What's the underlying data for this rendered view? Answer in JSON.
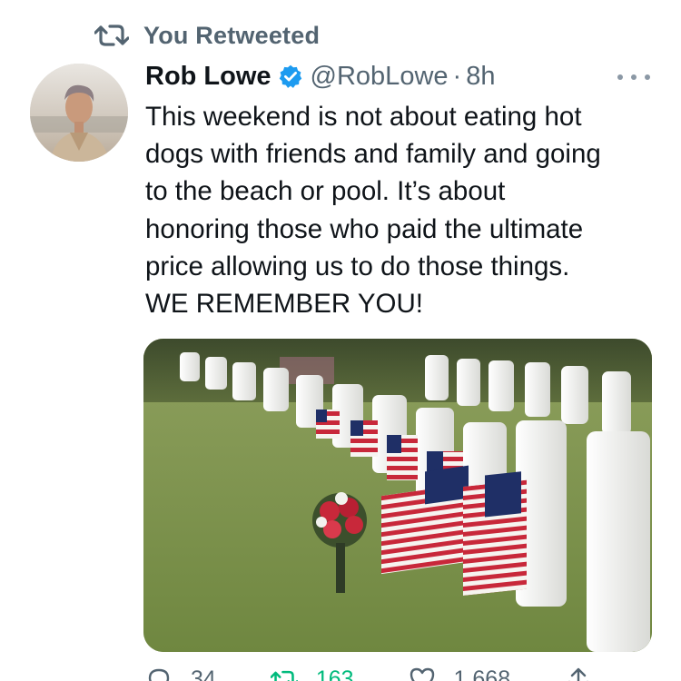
{
  "retweet_banner": {
    "label": "You Retweeted",
    "icon": "retweet-icon"
  },
  "tweet": {
    "author_name": "Rob Lowe",
    "handle": "@RobLowe",
    "separator": "·",
    "time": "8h",
    "verified": true,
    "text_lines": [
      "This weekend is not about eating hot",
      "dogs with friends and family and going",
      "to the beach or pool. It’s about",
      "honoring those who paid the ultimate",
      "price allowing us to do those things.",
      "WE REMEMBER YOU!"
    ],
    "media": {
      "icon": "cemetery-flags-photo"
    }
  },
  "actions": {
    "reply_count": "34",
    "retweet_count": "163",
    "like_count": "1,668"
  },
  "colors": {
    "primary_text": "#0f1419",
    "secondary_text": "#536471",
    "verified_blue": "#1d9bf0",
    "retweet_green": "#00ba7c"
  }
}
